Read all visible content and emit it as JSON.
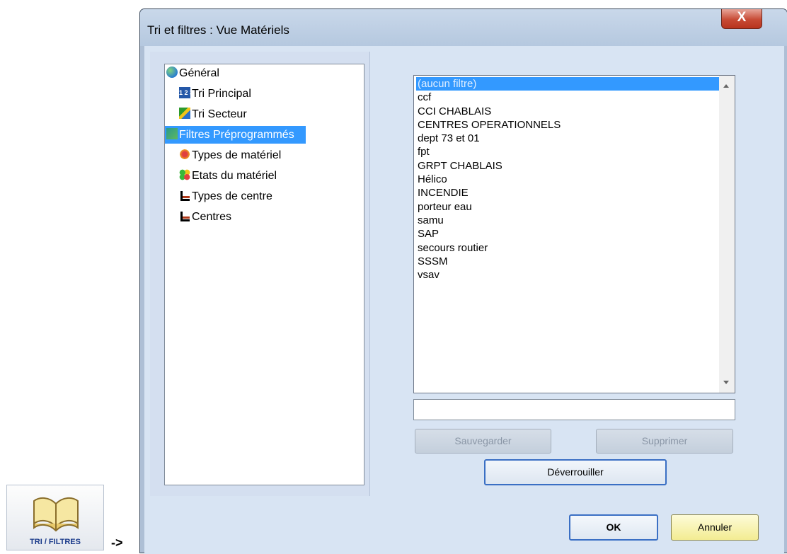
{
  "dialog": {
    "title": "Tri et filtres : Vue Matériels",
    "close_label": "X"
  },
  "tree": [
    {
      "label": "Général",
      "icon": "globe-icon",
      "level": 0,
      "selected": false
    },
    {
      "label": "Tri Principal",
      "icon": "numbered-list-icon",
      "level": 1,
      "selected": false
    },
    {
      "label": "Tri Secteur",
      "icon": "sector-map-icon",
      "level": 1,
      "selected": false
    },
    {
      "label": "Filtres Préprogrammés",
      "icon": "filters-icon",
      "level": 0,
      "selected": true
    },
    {
      "label": "Types de matériel",
      "icon": "material-type-icon",
      "level": 1,
      "selected": false
    },
    {
      "label": "Etats du matériel",
      "icon": "material-state-icon",
      "level": 1,
      "selected": false
    },
    {
      "label": "Types de centre",
      "icon": "centre-type-icon",
      "level": 1,
      "selected": false
    },
    {
      "label": "Centres",
      "icon": "centre-icon",
      "level": 1,
      "selected": false
    }
  ],
  "filter_list": {
    "selected_index": 0,
    "items": [
      "(aucun filtre)",
      "ccf",
      "CCI CHABLAIS",
      "CENTRES OPERATIONNELS",
      "dept 73 et 01",
      "fpt",
      "GRPT CHABLAIS",
      "Hélico",
      "INCENDIE",
      "porteur eau",
      "samu",
      "SAP",
      "secours routier",
      "SSSM",
      "vsav"
    ]
  },
  "filter_name_input": {
    "value": ""
  },
  "buttons": {
    "save": "Sauvegarder",
    "delete": "Supprimer",
    "unlock": "Déverrouiller",
    "ok": "OK",
    "cancel": "Annuler"
  },
  "toolbar": {
    "tri_filtres_label": "TRI / FILTRES",
    "arrow": "->"
  },
  "colors": {
    "selection": "#3399ff",
    "dialog_bg": "#d8e4f3",
    "close_button": "#c74a34",
    "ok_border": "#3a6fc4",
    "cancel_bg": "#f3ec92"
  }
}
